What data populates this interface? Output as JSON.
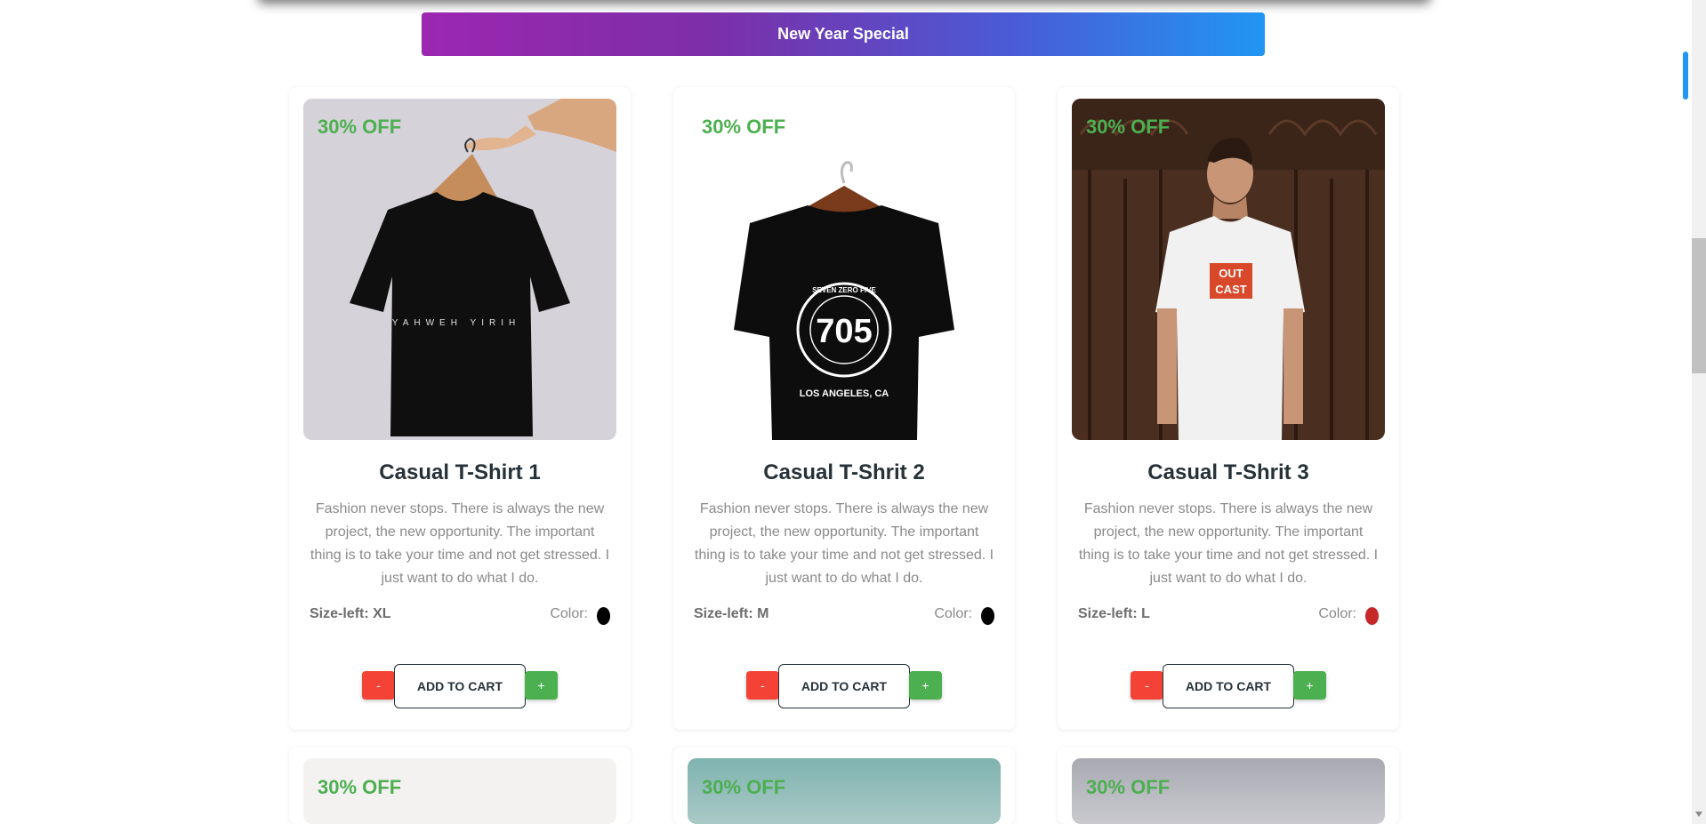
{
  "banner": {
    "label": "New Year Special"
  },
  "products": [
    {
      "discount": "30% OFF",
      "title": "Casual T-Shirt 1",
      "description": "Fashion never stops. There is always the new project, the new opportunity. The important thing is to take your time and not get stressed. I just want to do what I do.",
      "size": "Size-left: XL",
      "color_label": "Color:",
      "color": "#000000",
      "minus_label": "-",
      "add_label": "ADD TO CART",
      "plus_label": "+",
      "shirt_print": "YAHWEH YIRIH"
    },
    {
      "discount": "30% OFF",
      "title": "Casual T-Shrit 2",
      "description": "Fashion never stops. There is always the new project, the new opportunity. The important thing is to take your time and not get stressed. I just want to do what I do.",
      "size": "Size-left: M",
      "color_label": "Color:",
      "color": "#000000",
      "minus_label": "-",
      "add_label": "ADD TO CART",
      "plus_label": "+",
      "shirt_print_big": "705",
      "shirt_print_ring": "SEVEN ZERO FIVE",
      "shirt_print_sub": "LOS ANGELES, CA"
    },
    {
      "discount": "30% OFF",
      "title": "Casual T-Shrit 3",
      "description": "Fashion never stops. There is always the new project, the new opportunity. The important thing is to take your time and not get stressed. I just want to do what I do.",
      "size": "Size-left: L",
      "color_label": "Color:",
      "color": "#c62828",
      "minus_label": "-",
      "add_label": "ADD TO CART",
      "plus_label": "+",
      "shirt_print_line1": "OUT",
      "shirt_print_line2": "CAST"
    }
  ],
  "next_row": [
    {
      "discount": "30% OFF"
    },
    {
      "discount": "30% OFF"
    },
    {
      "discount": "30% OFF"
    }
  ],
  "colors": {
    "discount": "#4caf50",
    "minus": "#f44336",
    "plus": "#4caf50",
    "banner_start": "#9c27b0",
    "banner_end": "#2196f3"
  }
}
